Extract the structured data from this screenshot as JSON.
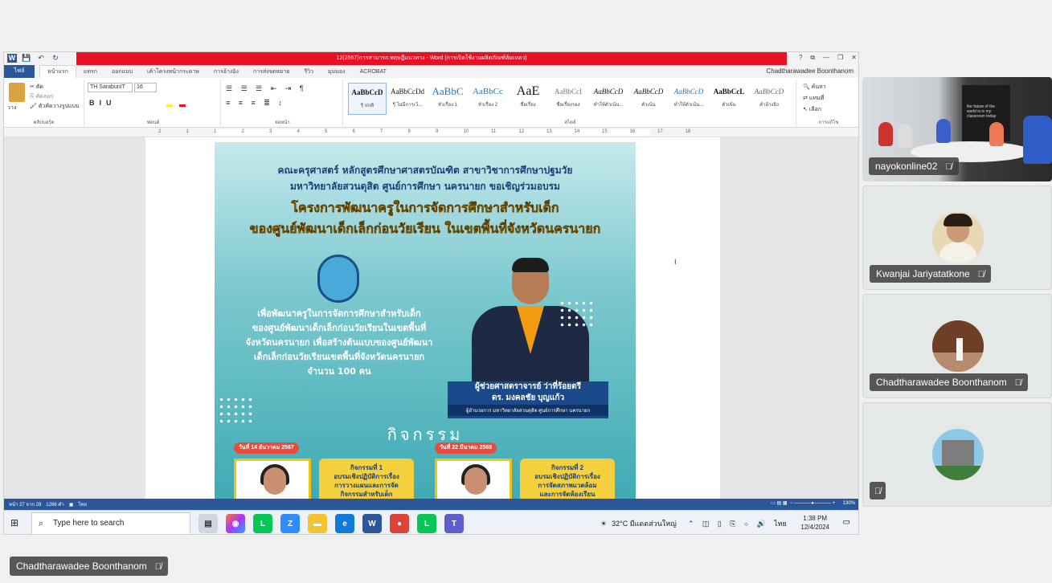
{
  "word": {
    "title": "12(2567)การสามารถ.ทฤษฎีแนวทาง - Word (การเปิดใช้งานผลิตภัณฑ์ล้มเหลว)",
    "quick_access": [
      "W",
      "💾",
      "↶",
      "↻"
    ],
    "window_controls": [
      "?",
      "⧉",
      "—",
      "❐",
      "✕"
    ],
    "user": "Chadtharawadee Boonthanom",
    "file_tab": "ไฟล์",
    "tabs": [
      "หน้าแรก",
      "แทรก",
      "ออกแบบ",
      "เค้าโครงหน้ากระดาษ",
      "การอ้างอิง",
      "การส่งจดหมาย",
      "รีวิว",
      "มุมมอง",
      "ACROBAT"
    ],
    "clipboard": {
      "paste": "วาง",
      "cut": "ตัด",
      "copy": "คัดลอก",
      "format_painter": "ตัวคัดวางรูปแบบ",
      "label": "คลิปบอร์ด"
    },
    "font": {
      "name": "TH SarabunIT",
      "size": "16",
      "label": "ฟอนต์"
    },
    "paragraph_label": "ย่อหน้า",
    "styles_label": "สไตล์",
    "styles": [
      {
        "sample": "AaBbCcD",
        "name": "¶ ปกติ"
      },
      {
        "sample": "AaBbCcDd",
        "name": "¶ ไม่มีการเว้..."
      },
      {
        "sample": "AaBbC",
        "name": "หัวเรื่อง 1"
      },
      {
        "sample": "AaBbCc",
        "name": "หัวเรื่อง 2"
      },
      {
        "sample": "AaE",
        "name": "ชื่อเรื่อง"
      },
      {
        "sample": "AaBbCcI",
        "name": "ชื่อเรื่องรอง"
      },
      {
        "sample": "AaBbCcD",
        "name": "ทำให้ตัวเน้น..."
      },
      {
        "sample": "AaBbCcD",
        "name": "ตัวเน้น"
      },
      {
        "sample": "AaBbCcD",
        "name": "ทำให้ตัวเน้น..."
      },
      {
        "sample": "AaBbCcL",
        "name": "ตัวเข้ม"
      },
      {
        "sample": "AaBbCcD",
        "name": "คำอ้างอิง"
      }
    ],
    "editing": {
      "find": "ค้นหา",
      "replace": "แทนที่",
      "select": "เลือก",
      "label": "การแก้ไข"
    },
    "ruler_numbers": [
      "2",
      "1",
      "1",
      "2",
      "3",
      "4",
      "5",
      "6",
      "7",
      "8",
      "9",
      "10",
      "11",
      "12",
      "13",
      "14",
      "15",
      "16",
      "17",
      "18"
    ],
    "status": {
      "page": "หน้า 27 จาก 29",
      "words": "1266 คำ",
      "lang": "ไทย",
      "zoom": "130%"
    }
  },
  "poster": {
    "line1": "คณะครุศาสตร์ หลักสูตรศึกษาศาสตรบัณฑิต สาขาวิชาการศึกษาปฐมวัย",
    "line2": "มหาวิทยาลัยสวนดุสิต ศูนย์การศึกษา นครนายก ขอเชิญร่วมอบรม",
    "headline1": "โครงการพัฒนาครูในการจัดการศึกษาสำหรับเด็ก",
    "headline2": "ของศูนย์พัฒนาเด็กเล็กก่อนวัยเรียน ในเขตพื้นที่จังหวัดนครนายก",
    "body1": "เพื่อพัฒนาครูในการจัดการศึกษาสำหรับเด็ก",
    "body2": "ของศูนย์พัฒนาเด็กเล็กก่อนวัยเรียนในเขตพื้นที่",
    "body3": "จังหวัดนครนายก เพื่อสร้างต้นแบบของศูนย์พัฒนา",
    "body4": "เด็กเล็กก่อนวัยเรียนเขตพื้นที่จังหวัดนครนายก",
    "body5": "จำนวน 100 คน",
    "speaker_title": "ผู้ช่วยศาสตราจารย์ ว่าที่ร้อยตรี",
    "speaker_name": "ดร. มงคลชัย บุญแก้ว",
    "speaker_role": "ผู้อำนวยการ มหาวิทยาลัยสวนดุสิต ศูนย์การศึกษา นครนายก",
    "activities_title": "กิจกรรม",
    "date1": "วันที่ 14 ธันวาคม 2567",
    "date2": "วันที่ 22 มีนาคม 2568",
    "act1_l1": "กิจกรรมที่ 1",
    "act1_l2": "อบรมเชิงปฏิบัติการเรื่อง",
    "act1_l3": "การวางแผนและการจัด",
    "act1_l4": "กิจกรรมสำหรับเด็ก",
    "act2_l1": "กิจกรรมที่ 2",
    "act2_l2": "อบรมเชิงปฏิบัติการเรื่อง",
    "act2_l3": "การจัดสภาพแวดล้อม",
    "act2_l4": "และการจัดห้องเรียน"
  },
  "taskbar": {
    "search_placeholder": "Type here to search",
    "weather": "32°C มีแดดส่วนใหญ่",
    "lang": "ไทย",
    "time": "1:38 PM",
    "date": "12/4/2024"
  },
  "participants": [
    {
      "name": "nayokonline02",
      "board_text": "the future of the world is in my classroom today"
    },
    {
      "name": "Kwanjai Jariyatatkone"
    },
    {
      "name": "Chadtharawadee Boonthanom"
    },
    {
      "name": ""
    }
  ],
  "presenter_label": "Chadtharawadee Boonthanom"
}
